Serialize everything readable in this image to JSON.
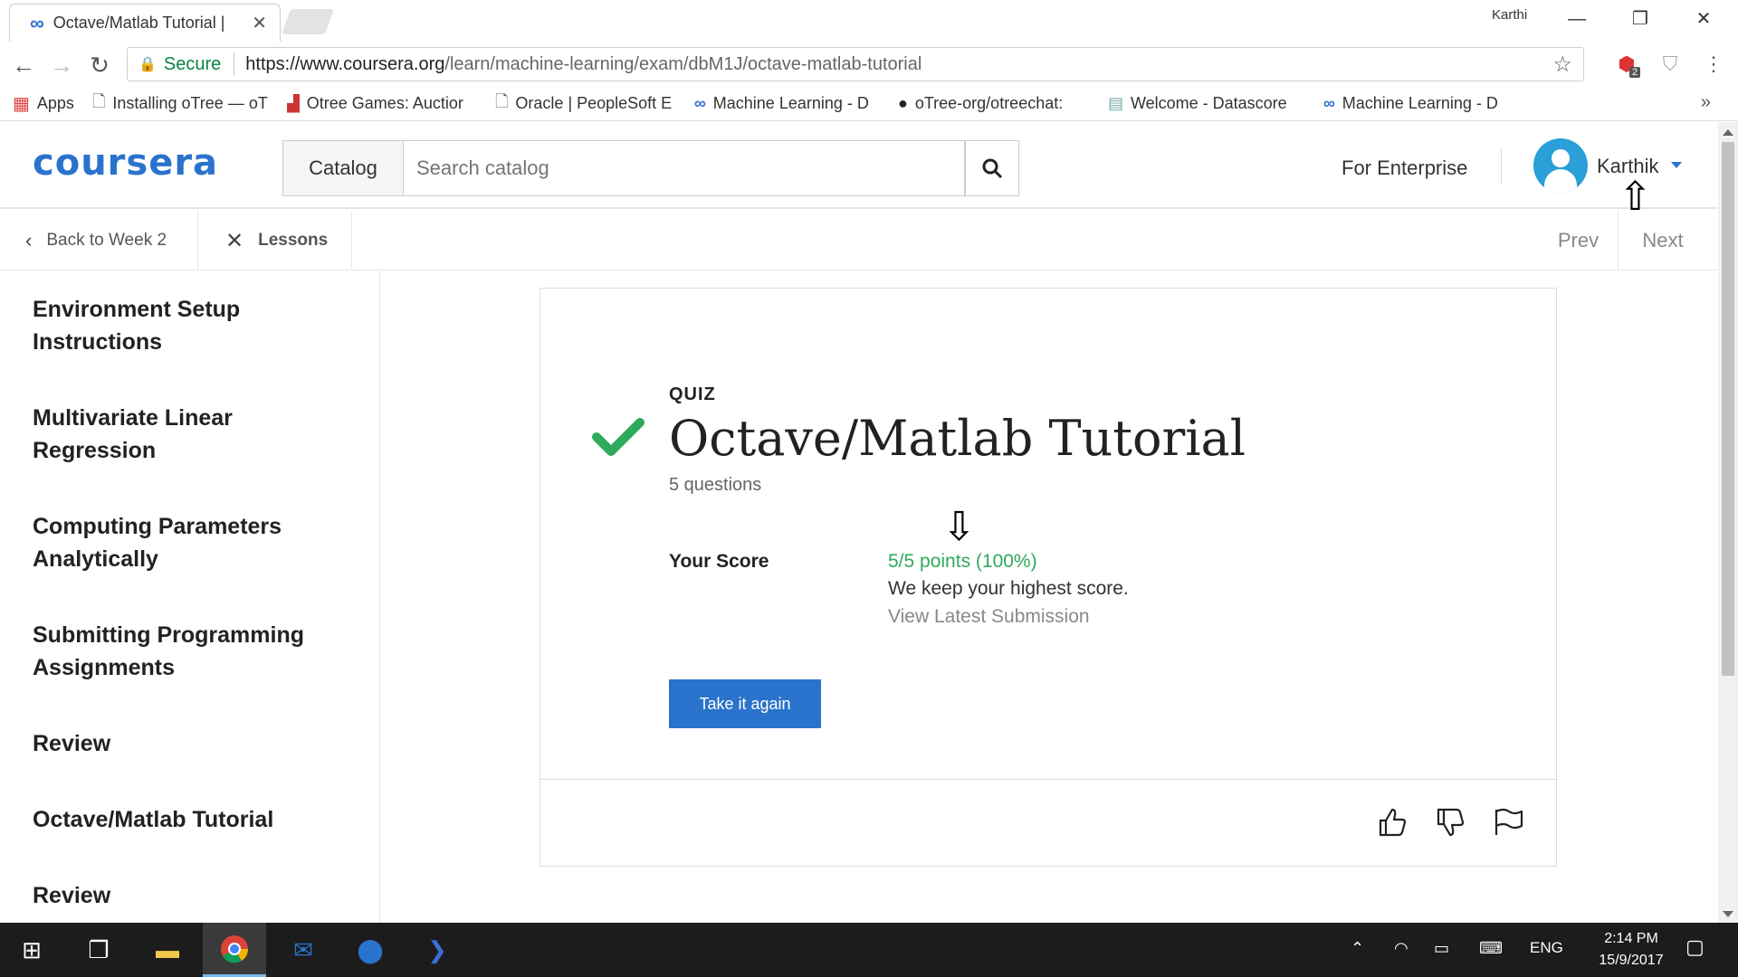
{
  "browser": {
    "tab_title": "Octave/Matlab Tutorial |",
    "tab_favicon": "infinity-icon",
    "profile_name": "Karthi",
    "secure_label": "Secure",
    "url_host": "https://www.coursera.org",
    "url_path": "/learn/machine-learning/exam/dbM1J/octave-matlab-tutorial",
    "extension_badge": "2"
  },
  "bookmarks": [
    {
      "label": "Apps",
      "icon": "apps-grid-icon"
    },
    {
      "label": "Installing oTree — oT",
      "icon": "page-icon"
    },
    {
      "label": "Otree Games: Auctior",
      "icon": "chart-icon"
    },
    {
      "label": "Oracle | PeopleSoft E",
      "icon": "page-icon"
    },
    {
      "label": "Machine Learning - D",
      "icon": "coursera-icon"
    },
    {
      "label": "oTree-org/otreechat:",
      "icon": "github-icon"
    },
    {
      "label": "Welcome - Datascore",
      "icon": "doc-icon"
    },
    {
      "label": "Machine Learning - D",
      "icon": "coursera-icon"
    }
  ],
  "header": {
    "logo": "coursera",
    "catalog_label": "Catalog",
    "search_placeholder": "Search catalog",
    "enterprise_label": "For Enterprise",
    "user_name": "Karthik"
  },
  "subnav": {
    "back_label": "Back to Week 2",
    "lessons_label": "Lessons",
    "prev_label": "Prev",
    "next_label": "Next"
  },
  "sidebar": {
    "items": [
      {
        "label": "Environment Setup Instructions"
      },
      {
        "label": "Multivariate Linear Regression"
      },
      {
        "label": "Computing Parameters Analytically"
      },
      {
        "label": "Submitting Programming Assignments"
      },
      {
        "label": "Review"
      },
      {
        "label": "Octave/Matlab Tutorial"
      },
      {
        "label": "Review"
      }
    ]
  },
  "quiz": {
    "type_label": "QUIZ",
    "title": "Octave/Matlab Tutorial",
    "question_count": "5 questions",
    "score_label": "Your Score",
    "score_value": "5/5 points (100%)",
    "score_note": "We keep your highest score.",
    "view_latest": "View Latest Submission",
    "retake_label": "Take it again"
  },
  "taskbar": {
    "language": "ENG",
    "time": "2:14 PM",
    "date": "15/9/2017"
  },
  "colors": {
    "brand_blue": "#2a73cc",
    "success_green": "#2eaa5c"
  }
}
